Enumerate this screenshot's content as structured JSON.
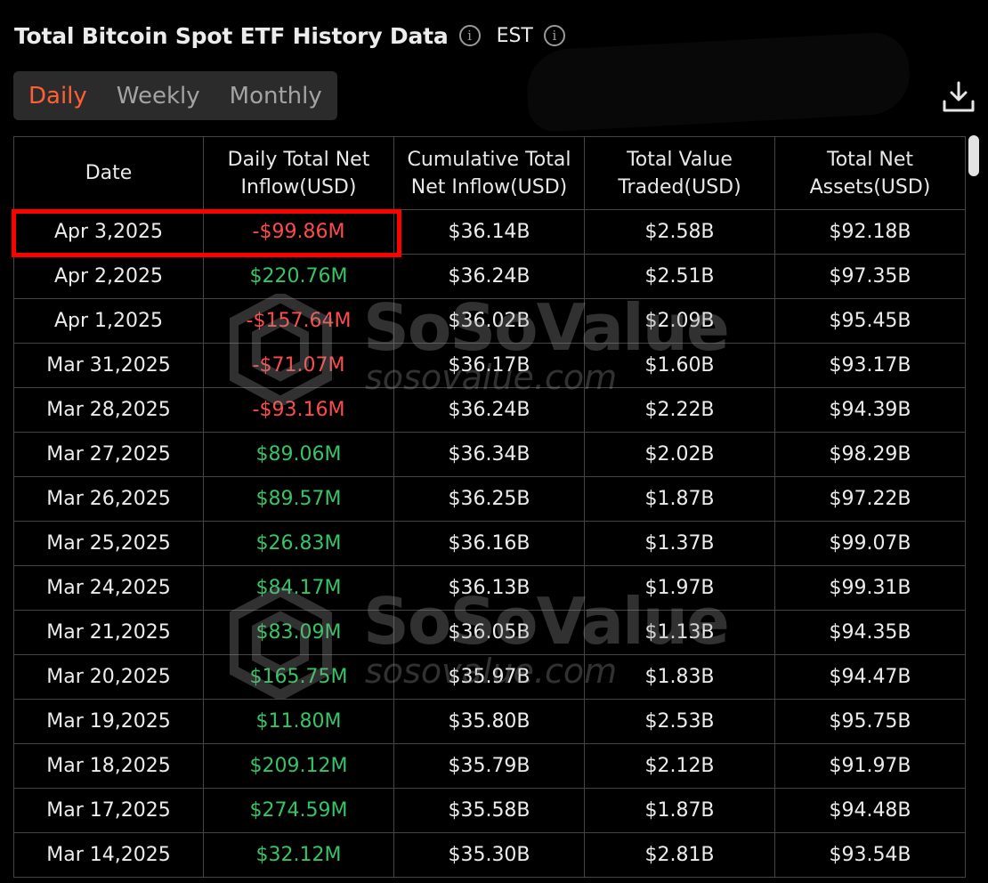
{
  "header": {
    "title": "Total Bitcoin Spot ETF History Data",
    "timezone": "EST"
  },
  "tabs": [
    {
      "label": "Daily",
      "active": true
    },
    {
      "label": "Weekly",
      "active": false
    },
    {
      "label": "Monthly",
      "active": false
    }
  ],
  "colors": {
    "accent": "#ff6033",
    "positive": "#36c466",
    "negative": "#ff4b4b",
    "highlight_box": "#ff0000"
  },
  "watermark": {
    "brand": "SoSoValue",
    "url": "sosovalue.com"
  },
  "table": {
    "columns": [
      [
        "Date"
      ],
      [
        "Daily Total Net",
        "Inflow(USD)"
      ],
      [
        "Cumulative Total",
        "Net Inflow(USD)"
      ],
      [
        "Total Value",
        "Traded(USD)"
      ],
      [
        "Total Net",
        "Assets(USD)"
      ]
    ],
    "rows": [
      {
        "date": "Apr 3,2025",
        "daily_net_inflow": "-$99.86M",
        "cumulative_net_inflow": "$36.14B",
        "value_traded": "$2.58B",
        "net_assets": "$92.18B",
        "sign": "neg"
      },
      {
        "date": "Apr 2,2025",
        "daily_net_inflow": "$220.76M",
        "cumulative_net_inflow": "$36.24B",
        "value_traded": "$2.51B",
        "net_assets": "$97.35B",
        "sign": "pos"
      },
      {
        "date": "Apr 1,2025",
        "daily_net_inflow": "-$157.64M",
        "cumulative_net_inflow": "$36.02B",
        "value_traded": "$2.09B",
        "net_assets": "$95.45B",
        "sign": "neg"
      },
      {
        "date": "Mar 31,2025",
        "daily_net_inflow": "-$71.07M",
        "cumulative_net_inflow": "$36.17B",
        "value_traded": "$1.60B",
        "net_assets": "$93.17B",
        "sign": "neg"
      },
      {
        "date": "Mar 28,2025",
        "daily_net_inflow": "-$93.16M",
        "cumulative_net_inflow": "$36.24B",
        "value_traded": "$2.22B",
        "net_assets": "$94.39B",
        "sign": "neg"
      },
      {
        "date": "Mar 27,2025",
        "daily_net_inflow": "$89.06M",
        "cumulative_net_inflow": "$36.34B",
        "value_traded": "$2.02B",
        "net_assets": "$98.29B",
        "sign": "pos"
      },
      {
        "date": "Mar 26,2025",
        "daily_net_inflow": "$89.57M",
        "cumulative_net_inflow": "$36.25B",
        "value_traded": "$1.87B",
        "net_assets": "$97.22B",
        "sign": "pos"
      },
      {
        "date": "Mar 25,2025",
        "daily_net_inflow": "$26.83M",
        "cumulative_net_inflow": "$36.16B",
        "value_traded": "$1.37B",
        "net_assets": "$99.07B",
        "sign": "pos"
      },
      {
        "date": "Mar 24,2025",
        "daily_net_inflow": "$84.17M",
        "cumulative_net_inflow": "$36.13B",
        "value_traded": "$1.97B",
        "net_assets": "$99.31B",
        "sign": "pos"
      },
      {
        "date": "Mar 21,2025",
        "daily_net_inflow": "$83.09M",
        "cumulative_net_inflow": "$36.05B",
        "value_traded": "$1.13B",
        "net_assets": "$94.35B",
        "sign": "pos"
      },
      {
        "date": "Mar 20,2025",
        "daily_net_inflow": "$165.75M",
        "cumulative_net_inflow": "$35.97B",
        "value_traded": "$1.83B",
        "net_assets": "$94.47B",
        "sign": "pos"
      },
      {
        "date": "Mar 19,2025",
        "daily_net_inflow": "$11.80M",
        "cumulative_net_inflow": "$35.80B",
        "value_traded": "$2.53B",
        "net_assets": "$95.75B",
        "sign": "pos"
      },
      {
        "date": "Mar 18,2025",
        "daily_net_inflow": "$209.12M",
        "cumulative_net_inflow": "$35.79B",
        "value_traded": "$2.12B",
        "net_assets": "$91.97B",
        "sign": "pos"
      },
      {
        "date": "Mar 17,2025",
        "daily_net_inflow": "$274.59M",
        "cumulative_net_inflow": "$35.58B",
        "value_traded": "$1.87B",
        "net_assets": "$94.48B",
        "sign": "pos"
      },
      {
        "date": "Mar 14,2025",
        "daily_net_inflow": "$32.12M",
        "cumulative_net_inflow": "$35.30B",
        "value_traded": "$2.81B",
        "net_assets": "$93.54B",
        "sign": "pos"
      }
    ]
  }
}
